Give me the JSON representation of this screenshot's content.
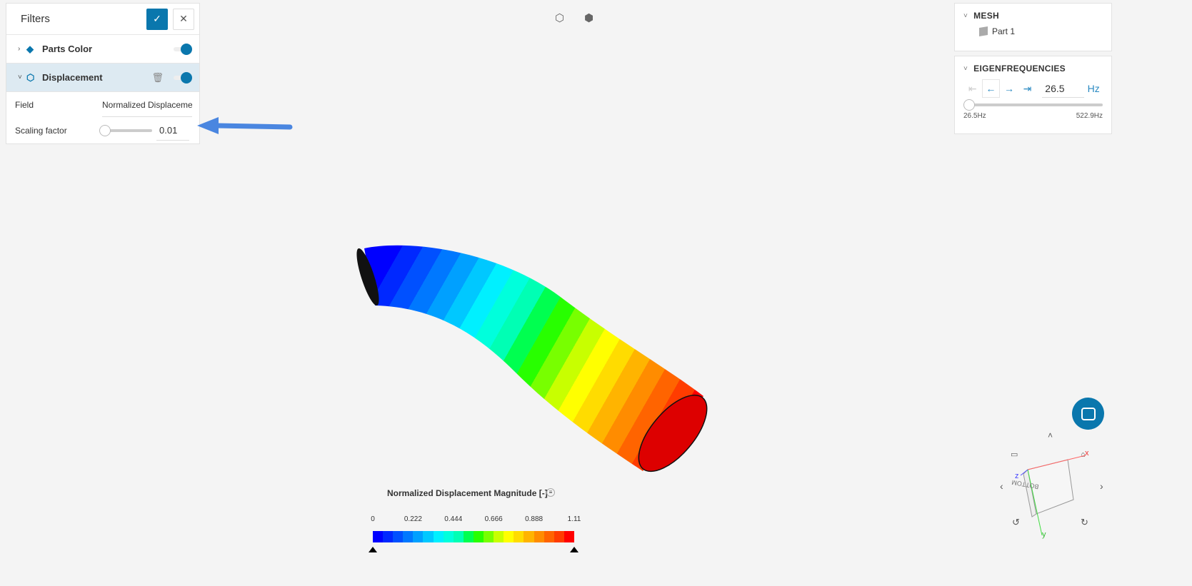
{
  "filters": {
    "title": "Filters",
    "confirm_icon": "✓",
    "close_icon": "✕",
    "items": [
      {
        "label": "Parts Color",
        "enabled": true
      },
      {
        "label": "Displacement",
        "enabled": true
      }
    ],
    "field_label": "Field",
    "field_value": "Normalized Displacement Magnitude",
    "scaling_label": "Scaling factor",
    "scaling_value": "0.01"
  },
  "mesh": {
    "title": "MESH",
    "part": "Part 1"
  },
  "eigen": {
    "title": "EIGENFREQUENCIES",
    "value": "26.5",
    "unit": "Hz",
    "min": "26.5Hz",
    "max": "522.9Hz",
    "slider_fraction": 0
  },
  "legend": {
    "title": "Normalized Displacement Magnitude [-]",
    "ticks": [
      "0",
      "0.222",
      "0.444",
      "0.666",
      "0.888",
      "1.11"
    ],
    "colors": [
      "#0000ff",
      "#0028ff",
      "#0050ff",
      "#0078ff",
      "#00a0ff",
      "#00c8ff",
      "#00f0ff",
      "#00ffdc",
      "#00ffb4",
      "#00ff50",
      "#28ff00",
      "#78ff00",
      "#c8ff00",
      "#ffff00",
      "#ffdc00",
      "#ffb400",
      "#ff8c00",
      "#ff6400",
      "#ff3c00",
      "#ff0000"
    ]
  },
  "gizmo": {
    "x": "x",
    "y": "y",
    "z": "z",
    "face": "BOTTOM"
  }
}
